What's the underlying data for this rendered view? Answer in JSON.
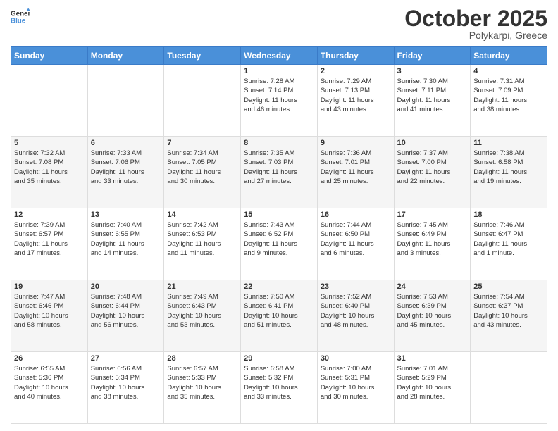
{
  "header": {
    "logo_line1": "General",
    "logo_line2": "Blue",
    "month": "October 2025",
    "location": "Polykarpi, Greece"
  },
  "days_of_week": [
    "Sunday",
    "Monday",
    "Tuesday",
    "Wednesday",
    "Thursday",
    "Friday",
    "Saturday"
  ],
  "weeks": [
    [
      {
        "day": "",
        "content": ""
      },
      {
        "day": "",
        "content": ""
      },
      {
        "day": "",
        "content": ""
      },
      {
        "day": "1",
        "content": "Sunrise: 7:28 AM\nSunset: 7:14 PM\nDaylight: 11 hours\nand 46 minutes."
      },
      {
        "day": "2",
        "content": "Sunrise: 7:29 AM\nSunset: 7:13 PM\nDaylight: 11 hours\nand 43 minutes."
      },
      {
        "day": "3",
        "content": "Sunrise: 7:30 AM\nSunset: 7:11 PM\nDaylight: 11 hours\nand 41 minutes."
      },
      {
        "day": "4",
        "content": "Sunrise: 7:31 AM\nSunset: 7:09 PM\nDaylight: 11 hours\nand 38 minutes."
      }
    ],
    [
      {
        "day": "5",
        "content": "Sunrise: 7:32 AM\nSunset: 7:08 PM\nDaylight: 11 hours\nand 35 minutes."
      },
      {
        "day": "6",
        "content": "Sunrise: 7:33 AM\nSunset: 7:06 PM\nDaylight: 11 hours\nand 33 minutes."
      },
      {
        "day": "7",
        "content": "Sunrise: 7:34 AM\nSunset: 7:05 PM\nDaylight: 11 hours\nand 30 minutes."
      },
      {
        "day": "8",
        "content": "Sunrise: 7:35 AM\nSunset: 7:03 PM\nDaylight: 11 hours\nand 27 minutes."
      },
      {
        "day": "9",
        "content": "Sunrise: 7:36 AM\nSunset: 7:01 PM\nDaylight: 11 hours\nand 25 minutes."
      },
      {
        "day": "10",
        "content": "Sunrise: 7:37 AM\nSunset: 7:00 PM\nDaylight: 11 hours\nand 22 minutes."
      },
      {
        "day": "11",
        "content": "Sunrise: 7:38 AM\nSunset: 6:58 PM\nDaylight: 11 hours\nand 19 minutes."
      }
    ],
    [
      {
        "day": "12",
        "content": "Sunrise: 7:39 AM\nSunset: 6:57 PM\nDaylight: 11 hours\nand 17 minutes."
      },
      {
        "day": "13",
        "content": "Sunrise: 7:40 AM\nSunset: 6:55 PM\nDaylight: 11 hours\nand 14 minutes."
      },
      {
        "day": "14",
        "content": "Sunrise: 7:42 AM\nSunset: 6:53 PM\nDaylight: 11 hours\nand 11 minutes."
      },
      {
        "day": "15",
        "content": "Sunrise: 7:43 AM\nSunset: 6:52 PM\nDaylight: 11 hours\nand 9 minutes."
      },
      {
        "day": "16",
        "content": "Sunrise: 7:44 AM\nSunset: 6:50 PM\nDaylight: 11 hours\nand 6 minutes."
      },
      {
        "day": "17",
        "content": "Sunrise: 7:45 AM\nSunset: 6:49 PM\nDaylight: 11 hours\nand 3 minutes."
      },
      {
        "day": "18",
        "content": "Sunrise: 7:46 AM\nSunset: 6:47 PM\nDaylight: 11 hours\nand 1 minute."
      }
    ],
    [
      {
        "day": "19",
        "content": "Sunrise: 7:47 AM\nSunset: 6:46 PM\nDaylight: 10 hours\nand 58 minutes."
      },
      {
        "day": "20",
        "content": "Sunrise: 7:48 AM\nSunset: 6:44 PM\nDaylight: 10 hours\nand 56 minutes."
      },
      {
        "day": "21",
        "content": "Sunrise: 7:49 AM\nSunset: 6:43 PM\nDaylight: 10 hours\nand 53 minutes."
      },
      {
        "day": "22",
        "content": "Sunrise: 7:50 AM\nSunset: 6:41 PM\nDaylight: 10 hours\nand 51 minutes."
      },
      {
        "day": "23",
        "content": "Sunrise: 7:52 AM\nSunset: 6:40 PM\nDaylight: 10 hours\nand 48 minutes."
      },
      {
        "day": "24",
        "content": "Sunrise: 7:53 AM\nSunset: 6:39 PM\nDaylight: 10 hours\nand 45 minutes."
      },
      {
        "day": "25",
        "content": "Sunrise: 7:54 AM\nSunset: 6:37 PM\nDaylight: 10 hours\nand 43 minutes."
      }
    ],
    [
      {
        "day": "26",
        "content": "Sunrise: 6:55 AM\nSunset: 5:36 PM\nDaylight: 10 hours\nand 40 minutes."
      },
      {
        "day": "27",
        "content": "Sunrise: 6:56 AM\nSunset: 5:34 PM\nDaylight: 10 hours\nand 38 minutes."
      },
      {
        "day": "28",
        "content": "Sunrise: 6:57 AM\nSunset: 5:33 PM\nDaylight: 10 hours\nand 35 minutes."
      },
      {
        "day": "29",
        "content": "Sunrise: 6:58 AM\nSunset: 5:32 PM\nDaylight: 10 hours\nand 33 minutes."
      },
      {
        "day": "30",
        "content": "Sunrise: 7:00 AM\nSunset: 5:31 PM\nDaylight: 10 hours\nand 30 minutes."
      },
      {
        "day": "31",
        "content": "Sunrise: 7:01 AM\nSunset: 5:29 PM\nDaylight: 10 hours\nand 28 minutes."
      },
      {
        "day": "",
        "content": ""
      }
    ]
  ]
}
